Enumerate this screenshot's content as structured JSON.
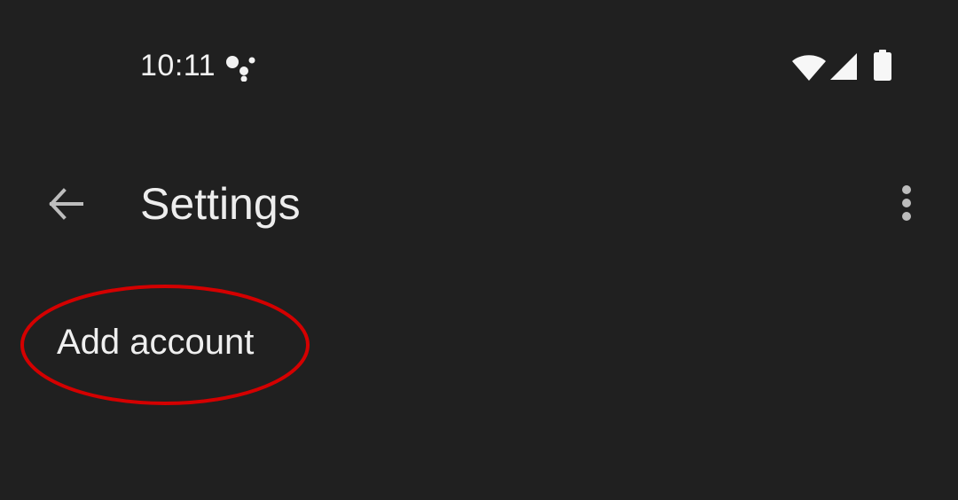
{
  "status_bar": {
    "time": "10:11",
    "icons": [
      "assistant-icon",
      "wifi-icon",
      "signal-icon",
      "battery-icon"
    ]
  },
  "app_bar": {
    "title": "Settings",
    "back_icon": "arrow-back-icon",
    "overflow_icon": "more-vert-icon"
  },
  "list": {
    "items": [
      {
        "label": "Add account"
      }
    ]
  },
  "colors": {
    "background": "#202020",
    "text": "#e8e8e8",
    "annotation": "#d40000"
  }
}
